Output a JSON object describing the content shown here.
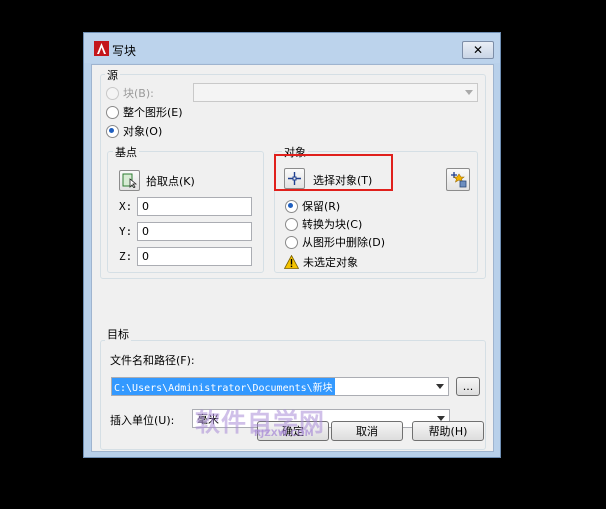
{
  "window": {
    "title": "写块",
    "close_symbol": "✕"
  },
  "source": {
    "group_label": "源",
    "options": [
      {
        "label": "块(B):",
        "checked": false,
        "disabled": true
      },
      {
        "label": "整个图形(E)",
        "checked": false,
        "disabled": false
      },
      {
        "label": "对象(O)",
        "checked": true,
        "disabled": false
      }
    ],
    "block_dropdown_value": ""
  },
  "basepoint": {
    "group_label": "基点",
    "pick_button_label": "拾取点(K)",
    "x_label": "X:",
    "x_value": "0",
    "y_label": "Y:",
    "y_value": "0",
    "z_label": "Z:",
    "z_value": "0"
  },
  "objects": {
    "group_label": "对象",
    "select_button_label": "选择对象(T)",
    "options": [
      {
        "label": "保留(R)",
        "checked": true
      },
      {
        "label": "转换为块(C)",
        "checked": false
      },
      {
        "label": "从图形中删除(D)",
        "checked": false
      }
    ],
    "warning_text": "未选定对象"
  },
  "target": {
    "group_label": "目标",
    "path_label": "文件名和路径(F):",
    "path_value": "C:\\Users\\Administrator\\Documents\\新块",
    "browse_label": "...",
    "units_label": "插入单位(U):",
    "units_value": "毫米"
  },
  "buttons": {
    "ok": "确定",
    "cancel": "取消",
    "help": "帮助(H)"
  },
  "watermark": {
    "text": "软件自学网",
    "sub": "RJZXW.COM"
  },
  "colors": {
    "highlight_box": "#e0201c",
    "selection": "#3399ff",
    "warning": "#f5c400"
  }
}
